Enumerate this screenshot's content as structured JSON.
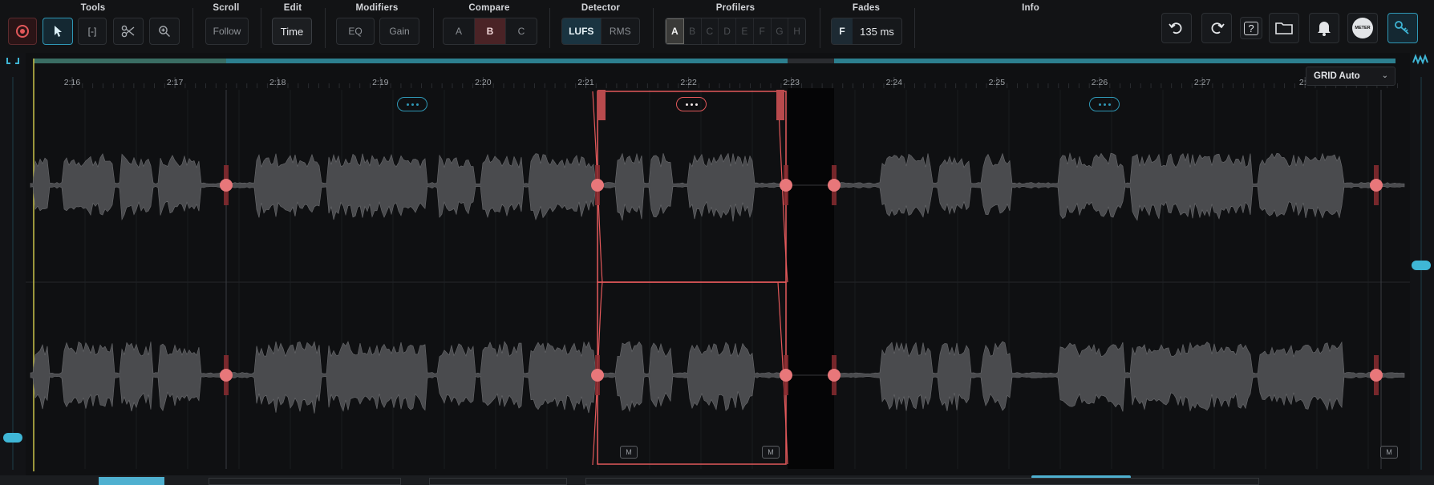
{
  "toolbar": {
    "groups": {
      "tools": "Tools",
      "scroll": "Scroll",
      "edit": "Edit",
      "modifiers": "Modifiers",
      "compare": "Compare",
      "detector": "Detector",
      "profilers": "Profilers",
      "fades": "Fades",
      "info": "Info"
    },
    "scroll_follow": "Follow",
    "edit_mode": "Time",
    "modifier_eq": "EQ",
    "modifier_gain": "Gain",
    "compare_options": [
      "A",
      "B",
      "C"
    ],
    "compare_selected": "B",
    "detector_options": [
      "LUFS",
      "RMS"
    ],
    "detector_selected": "LUFS",
    "profiler_options": [
      "A",
      "B",
      "C",
      "D",
      "E",
      "F",
      "G",
      "H"
    ],
    "profiler_selected": "A",
    "fades_type": "F",
    "fades_value": "135 ms",
    "help_label": "?",
    "meter_label": "METER"
  },
  "timeline": {
    "labels": [
      "2:16",
      "2:17",
      "2:18",
      "2:19",
      "2:20",
      "2:21",
      "2:22",
      "2:23",
      "2:24",
      "2:25",
      "2:26",
      "2:27",
      "2:2"
    ],
    "grid_mode": "GRID Auto"
  },
  "markers": {
    "m_label": "M"
  },
  "colors": {
    "accent_blue": "#2f97b5",
    "selection_red": "#e2585a",
    "waveform": "#4a4b4e",
    "background": "#0f1012"
  }
}
